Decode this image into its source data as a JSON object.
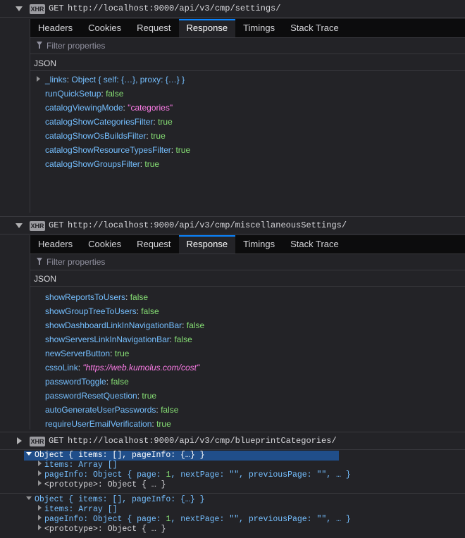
{
  "requests": [
    {
      "method": "GET",
      "badge": "XHR",
      "url": "http://localhost:9000/api/v3/cmp/settings/"
    },
    {
      "method": "GET",
      "badge": "XHR",
      "url": "http://localhost:9000/api/v3/cmp/miscellaneousSettings/"
    },
    {
      "method": "GET",
      "badge": "XHR",
      "url": "http://localhost:9000/api/v3/cmp/blueprintCategories/"
    }
  ],
  "tabs": [
    "Headers",
    "Cookies",
    "Request",
    "Response",
    "Timings",
    "Stack Trace"
  ],
  "selected_tab": "Response",
  "filter_placeholder": "Filter properties",
  "json_label": "JSON",
  "settings": {
    "links_key": "_links",
    "links_value": "Object { self: {…}, proxy: {…} }",
    "props": [
      {
        "key": "runQuickSetup",
        "value": "false"
      },
      {
        "key": "catalogViewingMode",
        "value": "\"categories\""
      },
      {
        "key": "catalogShowCategoriesFilter",
        "value": "true"
      },
      {
        "key": "catalogShowOsBuildsFilter",
        "value": "true"
      },
      {
        "key": "catalogShowResourceTypesFilter",
        "value": "true"
      },
      {
        "key": "catalogShowGroupsFilter",
        "value": "true"
      }
    ]
  },
  "misc": {
    "props": [
      {
        "key": "showReportsToUsers",
        "value": "false"
      },
      {
        "key": "showGroupTreeToUsers",
        "value": "false"
      },
      {
        "key": "showDashboardLinkInNavigationBar",
        "value": "false"
      },
      {
        "key": "showServersLinkInNavigationBar",
        "value": "false"
      },
      {
        "key": "newServerButton",
        "value": "true"
      },
      {
        "key": "cssoLink",
        "value": "\"https://web.kumolus.com/cost\""
      },
      {
        "key": "passwordToggle",
        "value": "false"
      },
      {
        "key": "passwordResetQuestion",
        "value": "true"
      },
      {
        "key": "autoGenerateUserPasswords",
        "value": "false"
      },
      {
        "key": "requireUserEmailVerification",
        "value": "true"
      }
    ]
  },
  "console_objects": [
    {
      "summary": "Object { items: [], pageInfo: {…} }",
      "items": "items: Array []",
      "pageinfo_pre": "pageInfo: Object { page: ",
      "pageinfo_num": "1",
      "pageinfo_post": ", nextPage: \"\", previousPage: \"\", … }",
      "proto": "<prototype>: Object { … }"
    },
    {
      "summary": "Object { items: [], pageInfo: {…} }",
      "items": "items: Array []",
      "pageinfo_pre": "pageInfo: Object { page: ",
      "pageinfo_num": "1",
      "pageinfo_post": ", nextPage: \"\", previousPage: \"\", … }",
      "proto": "<prototype>: Object { … }"
    }
  ],
  "colors": {
    "background": "#232327",
    "tab_strip": "#0c0c0d",
    "accent": "#0a84ff",
    "key": "#75bfff",
    "boolean": "#86de74",
    "string": "#ff7de9",
    "highlight": "#204e8a"
  }
}
